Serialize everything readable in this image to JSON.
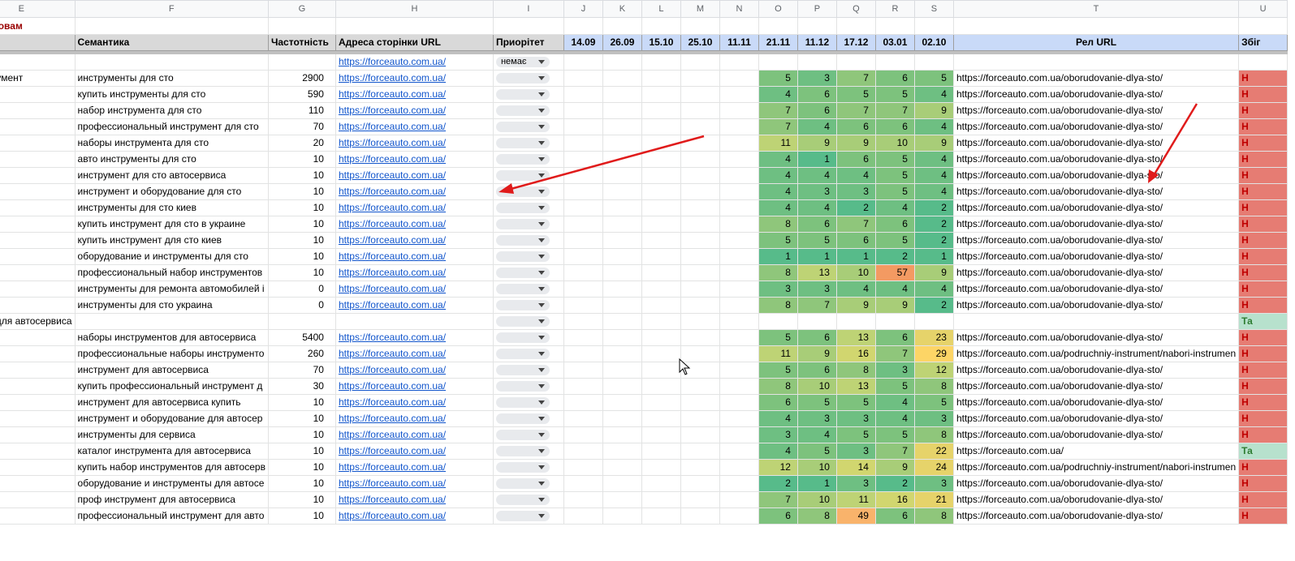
{
  "sheet": {
    "columns": [
      "E",
      "F",
      "G",
      "H",
      "I",
      "J",
      "K",
      "L",
      "M",
      "N",
      "O",
      "P",
      "Q",
      "R",
      "S",
      "T",
      "U"
    ],
    "subtitle": "им словам",
    "headers": {
      "e": "",
      "f": "Семантика",
      "g": "Частотність",
      "h": "Адреса сторінки URL",
      "i": "Приорітет",
      "dates": [
        "14.09",
        "26.09",
        "15.10",
        "25.10",
        "11.11",
        "21.11",
        "11.12",
        "17.12",
        "03.01",
        "02.10"
      ],
      "t": "Рел URL",
      "u": "Збіг "
    },
    "rows": [
      {
        "e": "",
        "f": "",
        "g": "",
        "h": "https://forceauto.com.ua/",
        "i": "немає",
        "pos": [
          "",
          "",
          "",
          "",
          ""
        ],
        "t": "",
        "u": ""
      },
      {
        "e": "инструмент",
        "f": "инструменты для сто",
        "g": "2900",
        "h": "https://forceauto.com.ua/",
        "i": "",
        "pos": [
          "5",
          "3",
          "7",
          "6",
          "5"
        ],
        "t": "https://forceauto.com.ua/oborudovanie-dlya-sto/",
        "u": "Н"
      },
      {
        "e": "",
        "f": "купить инструменты для сто",
        "g": "590",
        "h": "https://forceauto.com.ua/",
        "i": "",
        "pos": [
          "4",
          "6",
          "5",
          "5",
          "4"
        ],
        "t": "https://forceauto.com.ua/oborudovanie-dlya-sto/",
        "u": "Н"
      },
      {
        "e": "",
        "f": "набор инструмента для сто",
        "g": "110",
        "h": "https://forceauto.com.ua/",
        "i": "",
        "pos": [
          "7",
          "6",
          "7",
          "7",
          "9"
        ],
        "t": "https://forceauto.com.ua/oborudovanie-dlya-sto/",
        "u": "Н"
      },
      {
        "e": "",
        "f": "профессиональный инструмент для сто",
        "g": "70",
        "h": "https://forceauto.com.ua/",
        "i": "",
        "pos": [
          "7",
          "4",
          "6",
          "6",
          "4"
        ],
        "t": "https://forceauto.com.ua/oborudovanie-dlya-sto/",
        "u": "Н"
      },
      {
        "e": "",
        "f": "наборы инструмента для сто",
        "g": "20",
        "h": "https://forceauto.com.ua/",
        "i": "",
        "pos": [
          "11",
          "9",
          "9",
          "10",
          "9"
        ],
        "t": "https://forceauto.com.ua/oborudovanie-dlya-sto/",
        "u": "Н"
      },
      {
        "e": "",
        "f": "авто инструменты для сто",
        "g": "10",
        "h": "https://forceauto.com.ua/",
        "i": "",
        "pos": [
          "4",
          "1",
          "6",
          "5",
          "4"
        ],
        "t": "https://forceauto.com.ua/oborudovanie-dlya-sto/",
        "u": "Н"
      },
      {
        "e": "",
        "f": "инструмент для сто автосервиса",
        "g": "10",
        "h": "https://forceauto.com.ua/",
        "i": "",
        "pos": [
          "4",
          "4",
          "4",
          "5",
          "4"
        ],
        "t": "https://forceauto.com.ua/oborudovanie-dlya-sto/",
        "u": "Н"
      },
      {
        "e": "",
        "f": "инструмент и оборудование для сто",
        "g": "10",
        "h": "https://forceauto.com.ua/",
        "i": "",
        "pos": [
          "4",
          "3",
          "3",
          "5",
          "4"
        ],
        "t": "https://forceauto.com.ua/oborudovanie-dlya-sto/",
        "u": "Н"
      },
      {
        "e": "",
        "f": "инструменты для сто киев",
        "g": "10",
        "h": "https://forceauto.com.ua/",
        "i": "",
        "pos": [
          "4",
          "4",
          "2",
          "4",
          "2"
        ],
        "t": "https://forceauto.com.ua/oborudovanie-dlya-sto/",
        "u": "Н"
      },
      {
        "e": "",
        "f": "купить инструмент для сто в украине",
        "g": "10",
        "h": "https://forceauto.com.ua/",
        "i": "",
        "pos": [
          "8",
          "6",
          "7",
          "6",
          "2"
        ],
        "t": "https://forceauto.com.ua/oborudovanie-dlya-sto/",
        "u": "Н"
      },
      {
        "e": "",
        "f": "купить инструмент для сто киев",
        "g": "10",
        "h": "https://forceauto.com.ua/",
        "i": "",
        "pos": [
          "5",
          "5",
          "6",
          "5",
          "2"
        ],
        "t": "https://forceauto.com.ua/oborudovanie-dlya-sto/",
        "u": "Н"
      },
      {
        "e": "",
        "f": "оборудование и инструменты для сто",
        "g": "10",
        "h": "https://forceauto.com.ua/",
        "i": "",
        "pos": [
          "1",
          "1",
          "1",
          "2",
          "1"
        ],
        "t": "https://forceauto.com.ua/oborudovanie-dlya-sto/",
        "u": "Н"
      },
      {
        "e": "",
        "f": "профессиональный набор инструментов",
        "g": "10",
        "h": "https://forceauto.com.ua/",
        "i": "",
        "pos": [
          "8",
          "13",
          "10",
          "57",
          "9"
        ],
        "t": "https://forceauto.com.ua/oborudovanie-dlya-sto/",
        "u": "Н"
      },
      {
        "e": "",
        "f": "инструменты для ремонта автомобилей i",
        "g": "0",
        "h": "https://forceauto.com.ua/",
        "i": "",
        "pos": [
          "3",
          "3",
          "4",
          "4",
          "4"
        ],
        "t": "https://forceauto.com.ua/oborudovanie-dlya-sto/",
        "u": "Н"
      },
      {
        "e": "",
        "f": "инструменты для сто украина",
        "g": "0",
        "h": "https://forceauto.com.ua/",
        "i": "",
        "pos": [
          "8",
          "7",
          "9",
          "9",
          "2"
        ],
        "t": "https://forceauto.com.ua/oborudovanie-dlya-sto/",
        "u": "Н"
      },
      {
        "e": "енты для автосервиса",
        "f": "",
        "g": "",
        "h": "",
        "i": "",
        "pos": [
          "",
          "",
          "",
          "",
          ""
        ],
        "t": "",
        "u": "Та"
      },
      {
        "e": "",
        "f": "наборы инструментов для автосервиса",
        "g": "5400",
        "h": "https://forceauto.com.ua/",
        "i": "",
        "pos": [
          "5",
          "6",
          "13",
          "6",
          "23"
        ],
        "t": "https://forceauto.com.ua/oborudovanie-dlya-sto/",
        "u": "Н"
      },
      {
        "e": "",
        "f": "профессиональные наборы инструменто",
        "g": "260",
        "h": "https://forceauto.com.ua/",
        "i": "",
        "pos": [
          "11",
          "9",
          "16",
          "7",
          "29"
        ],
        "t": "https://forceauto.com.ua/podruchniy-instrument/nabori-instrumen",
        "u": "Н"
      },
      {
        "e": "",
        "f": "инструмент для автосервиса",
        "g": "70",
        "h": "https://forceauto.com.ua/",
        "i": "",
        "pos": [
          "5",
          "6",
          "8",
          "3",
          "12"
        ],
        "t": "https://forceauto.com.ua/oborudovanie-dlya-sto/",
        "u": "Н"
      },
      {
        "e": "",
        "f": "купить профессиональный инструмент д",
        "g": "30",
        "h": "https://forceauto.com.ua/",
        "i": "",
        "pos": [
          "8",
          "10",
          "13",
          "5",
          "8"
        ],
        "t": "https://forceauto.com.ua/oborudovanie-dlya-sto/",
        "u": "Н"
      },
      {
        "e": "",
        "f": "инструмент для автосервиса купить",
        "g": "10",
        "h": "https://forceauto.com.ua/",
        "i": "",
        "pos": [
          "6",
          "5",
          "5",
          "4",
          "5"
        ],
        "t": "https://forceauto.com.ua/oborudovanie-dlya-sto/",
        "u": "Н"
      },
      {
        "e": "",
        "f": "инструмент и оборудование для автосер",
        "g": "10",
        "h": "https://forceauto.com.ua/",
        "i": "",
        "pos": [
          "4",
          "3",
          "3",
          "4",
          "3"
        ],
        "t": "https://forceauto.com.ua/oborudovanie-dlya-sto/",
        "u": "Н"
      },
      {
        "e": "",
        "f": "инструменты для сервиса",
        "g": "10",
        "h": "https://forceauto.com.ua/",
        "i": "",
        "pos": [
          "3",
          "4",
          "5",
          "5",
          "8"
        ],
        "t": "https://forceauto.com.ua/oborudovanie-dlya-sto/",
        "u": "Н"
      },
      {
        "e": "",
        "f": "каталог инструмента для автосервиса",
        "g": "10",
        "h": "https://forceauto.com.ua/",
        "i": "",
        "pos": [
          "4",
          "5",
          "3",
          "7",
          "22"
        ],
        "t": "https://forceauto.com.ua/",
        "u": "Та"
      },
      {
        "e": "",
        "f": "купить набор инструментов для автосерв",
        "g": "10",
        "h": "https://forceauto.com.ua/",
        "i": "",
        "pos": [
          "12",
          "10",
          "14",
          "9",
          "24"
        ],
        "t": "https://forceauto.com.ua/podruchniy-instrument/nabori-instrumen",
        "u": "Н"
      },
      {
        "e": "",
        "f": "оборудование и инструменты для автосе",
        "g": "10",
        "h": "https://forceauto.com.ua/",
        "i": "",
        "pos": [
          "2",
          "1",
          "3",
          "2",
          "3"
        ],
        "t": "https://forceauto.com.ua/oborudovanie-dlya-sto/",
        "u": "Н"
      },
      {
        "e": "",
        "f": "проф инструмент для автосервиса",
        "g": "10",
        "h": "https://forceauto.com.ua/",
        "i": "",
        "pos": [
          "7",
          "10",
          "11",
          "16",
          "21"
        ],
        "t": "https://forceauto.com.ua/oborudovanie-dlya-sto/",
        "u": "Н"
      },
      {
        "e": "",
        "f": "профессиональный инструмент для авто",
        "g": "10",
        "h": "https://forceauto.com.ua/",
        "i": "",
        "pos": [
          "6",
          "8",
          "49",
          "6",
          "8"
        ],
        "t": "https://forceauto.com.ua/oborudovanie-dlya-sto/",
        "u": "Н"
      }
    ]
  },
  "colors": {
    "arrow": "#e01b1b",
    "zbig_red": "#e67c73",
    "zbig_green": "#b7e1cd",
    "date_header": "#c9daf8"
  }
}
